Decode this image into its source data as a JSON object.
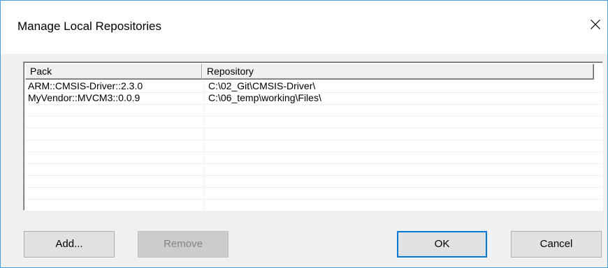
{
  "window": {
    "title": "Manage Local Repositories",
    "close_glyph": "✕"
  },
  "list": {
    "columns": [
      {
        "label": "Pack"
      },
      {
        "label": "Repository"
      }
    ],
    "rows": [
      {
        "pack": "ARM::CMSIS-Driver::2.3.0",
        "repository": "C:\\02_Git\\CMSIS-Driver\\"
      },
      {
        "pack": "MyVendor::MVCM3::0.0.9",
        "repository": "C:\\06_temp\\working\\Files\\"
      }
    ]
  },
  "buttons": {
    "add": "Add...",
    "remove": "Remove",
    "ok": "OK",
    "cancel": "Cancel"
  },
  "colors": {
    "window_border": "#4a9fd8",
    "default_button_border": "#0078d7",
    "disabled_text": "#838383"
  },
  "icons": {
    "close": "close-icon"
  }
}
